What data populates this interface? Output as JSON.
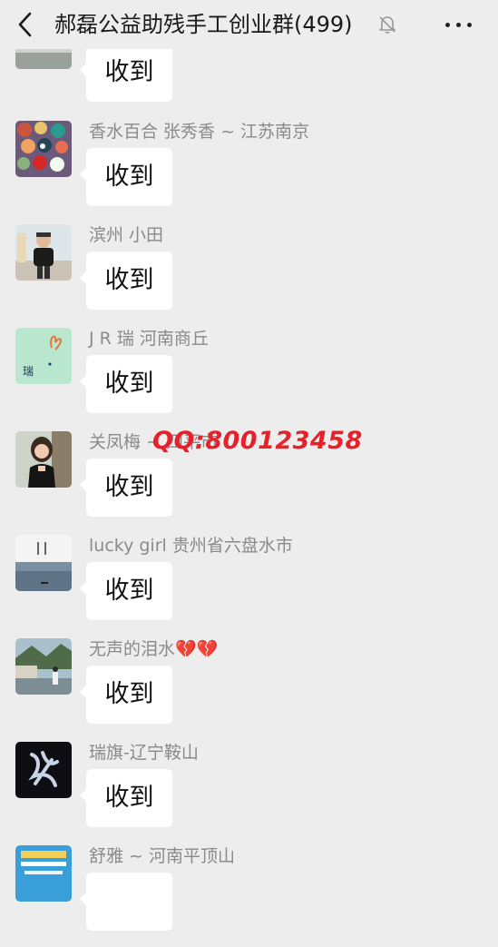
{
  "header": {
    "title": "郝磊公益助残手工创业群(499)",
    "back_icon": "chevron-left-icon",
    "mute_icon": "bell-off-icon",
    "more_icon": "more-dots-icon"
  },
  "watermark": "QQ:800123458",
  "messages": [
    {
      "sender": "",
      "text": "收到",
      "avatar": "partial-gray"
    },
    {
      "sender": "香水百合 张秀香 ~ 江苏南京",
      "text": "收到",
      "avatar": "colorful-crafts"
    },
    {
      "sender": "滨州  小田",
      "text": "收到",
      "avatar": "person-black-shirt"
    },
    {
      "sender": "J R 瑞  河南商丘",
      "text": "收到",
      "avatar": "mint-drawing-rui"
    },
    {
      "sender": "关凤梅 ~ 四平市",
      "text": "收到",
      "avatar": "girl-portrait"
    },
    {
      "sender": "lucky girl 贵州省六盘水市",
      "text": "收到",
      "avatar": "sky-landscape"
    },
    {
      "sender": "无声的泪水💔💔",
      "text": "收到",
      "avatar": "person-riverside"
    },
    {
      "sender": "瑞旗-辽宁鞍山",
      "text": "收到",
      "avatar": "dark-calligraphy"
    },
    {
      "sender": "舒雅 ~ 河南平顶山",
      "text": "",
      "avatar": "blue-poster"
    }
  ],
  "colors": {
    "background": "#ededed",
    "bubble": "#ffffff",
    "watermark": "#e8202a",
    "sender_name": "#8a8a8a"
  }
}
